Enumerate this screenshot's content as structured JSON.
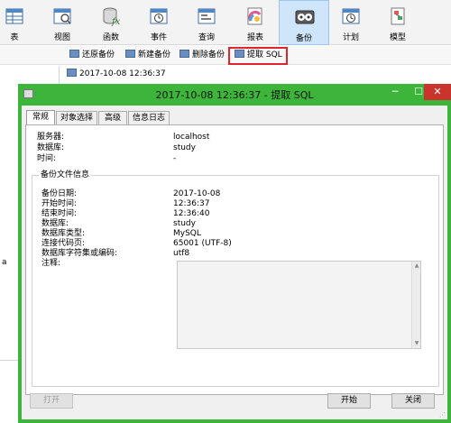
{
  "toolbar": {
    "items": [
      {
        "label": "表",
        "icon": "table-icon"
      },
      {
        "label": "视图",
        "icon": "view-icon"
      },
      {
        "label": "函数",
        "icon": "function-icon"
      },
      {
        "label": "事件",
        "icon": "event-clock-icon"
      },
      {
        "label": "查询",
        "icon": "query-icon"
      },
      {
        "label": "报表",
        "icon": "report-icon"
      },
      {
        "label": "备份",
        "icon": "backup-icon",
        "active": true
      },
      {
        "label": "计划",
        "icon": "schedule-icon"
      },
      {
        "label": "模型",
        "icon": "model-icon"
      }
    ]
  },
  "subbar": {
    "restore": "还原备份",
    "new": "新建备份",
    "delete": "删除备份",
    "extract": "提取 SQL"
  },
  "list": {
    "item": "2017-10-08 12:36:37",
    "edge_char": "a"
  },
  "dialog": {
    "title": "2017-10-08 12:36:37 - 提取 SQL",
    "win_min": "─",
    "win_max": "☐",
    "win_close": "✕",
    "tabs": [
      "常规",
      "对象选择",
      "高级",
      "信息日志"
    ],
    "general": {
      "server_label": "服务器:",
      "server_value": "localhost",
      "database_label": "数据库:",
      "database_value": "study",
      "time_label": "时间:",
      "time_value": "-"
    },
    "backup_info": {
      "title": "备份文件信息",
      "date_label": "备份日期:",
      "date_value": "2017-10-08",
      "start_label": "开始时间:",
      "start_value": "12:36:37",
      "end_label": "结束时间:",
      "end_value": "12:36:40",
      "db_label": "数据库:",
      "db_value": "study",
      "dbtype_label": "数据库类型:",
      "dbtype_value": "MySQL",
      "codepage_label": "连接代码页:",
      "codepage_value": "65001 (UTF-8)",
      "charset_label": "数据库字符集或编码:",
      "charset_value": "utf8",
      "notes_label": "注释:"
    },
    "buttons": {
      "open": "打开",
      "start": "开始",
      "close": "关闭"
    }
  },
  "colors": {
    "dialog_border": "#3db53a",
    "close_button": "#c9342d",
    "highlight_box": "#e0262c",
    "active_tool": "#cfe5fa"
  }
}
